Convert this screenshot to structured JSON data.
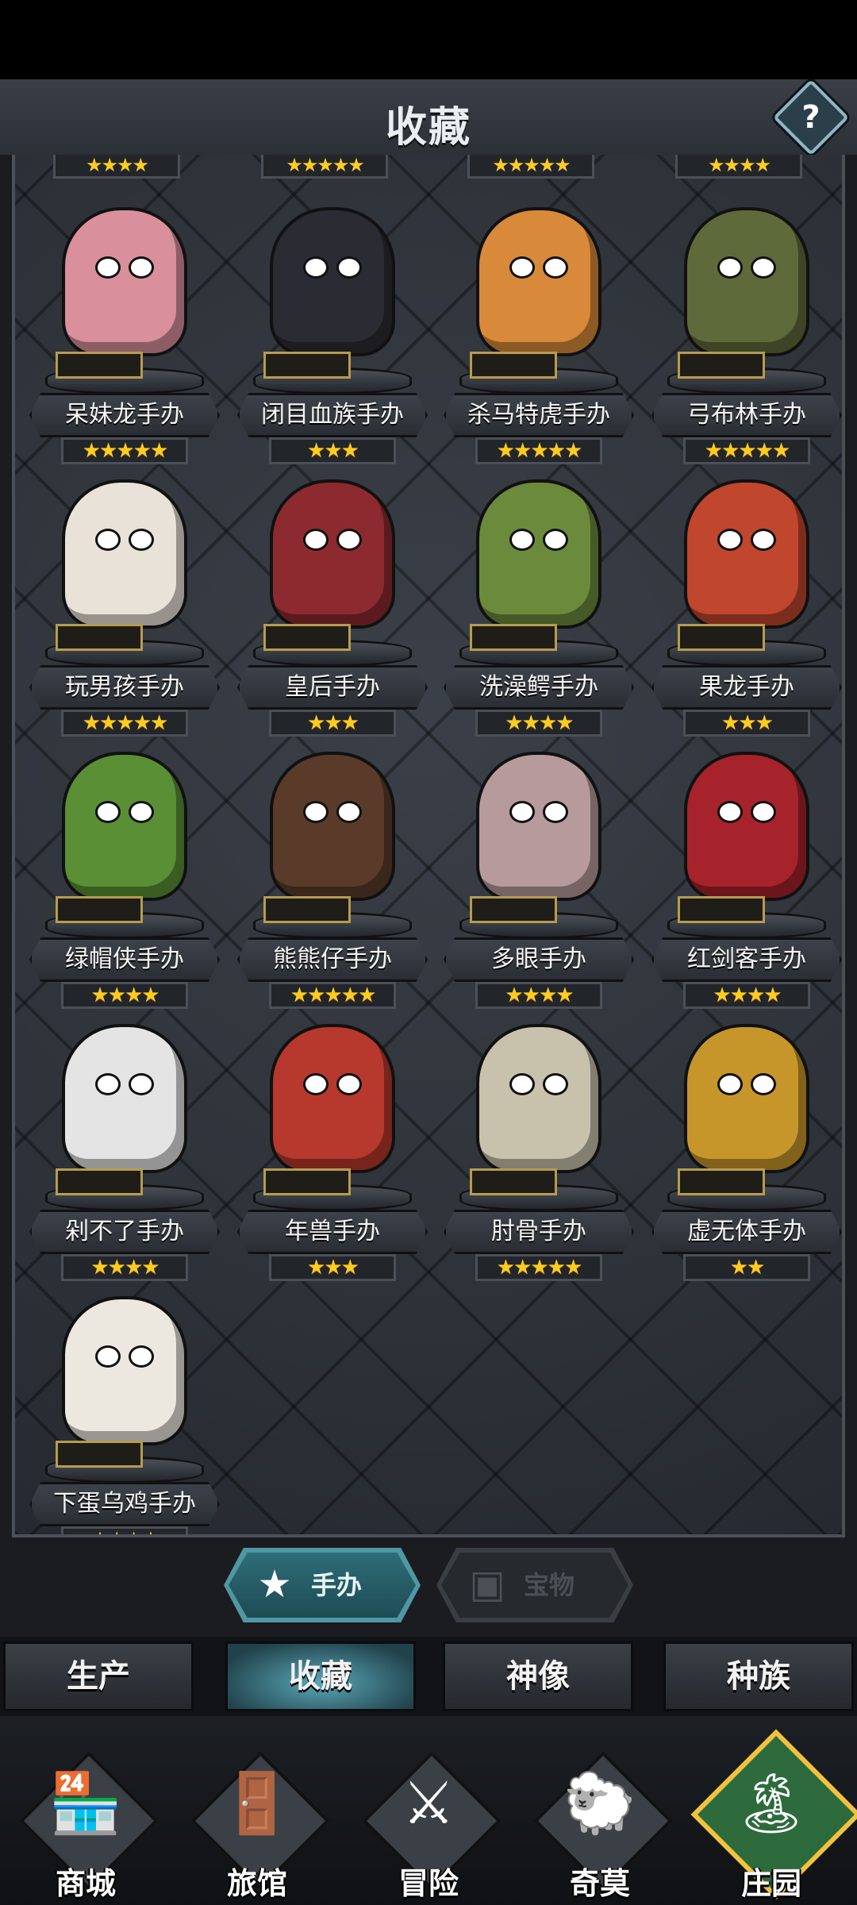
{
  "header": {
    "title": "收藏",
    "help_icon": "?"
  },
  "top_row_stars": [
    "★★★★",
    "★★★★★",
    "★★★★★",
    "★★★★"
  ],
  "figures": [
    {
      "name": "呆妹龙手办",
      "stars": "★★★★★",
      "color": "#d98f9c"
    },
    {
      "name": "闭目血族手办",
      "stars": "★★★",
      "color": "#2b2b33"
    },
    {
      "name": "杀马特虎手办",
      "stars": "★★★★★",
      "color": "#d88a3a"
    },
    {
      "name": "弓布林手办",
      "stars": "★★★★★",
      "color": "#5f6a3b"
    },
    {
      "name": "玩男孩手办",
      "stars": "★★★★★",
      "color": "#e8e2d8"
    },
    {
      "name": "皇后手办",
      "stars": "★★★",
      "color": "#8d2a2f"
    },
    {
      "name": "洗澡鳄手办",
      "stars": "★★★★",
      "color": "#6c8a3c"
    },
    {
      "name": "果龙手办",
      "stars": "★★★",
      "color": "#c0462e"
    },
    {
      "name": "绿帽侠手办",
      "stars": "★★★★",
      "color": "#5a8f35"
    },
    {
      "name": "熊熊仔手办",
      "stars": "★★★★★",
      "color": "#5a3b2a"
    },
    {
      "name": "多眼手办",
      "stars": "★★★★",
      "color": "#b79a9c"
    },
    {
      "name": "红剑客手办",
      "stars": "★★★★",
      "color": "#a7232b"
    },
    {
      "name": "剁不了手办",
      "stars": "★★★★",
      "color": "#e4e4e4"
    },
    {
      "name": "年兽手办",
      "stars": "★★★",
      "color": "#b7382c"
    },
    {
      "name": "肘骨手办",
      "stars": "★★★★★",
      "color": "#c8c2ad"
    },
    {
      "name": "虚无体手办",
      "stars": "★★",
      "color": "#c7962b"
    },
    {
      "name": "下蛋乌鸡手办",
      "stars": "★★★★",
      "color": "#ece7df"
    }
  ],
  "category_tabs": [
    {
      "label": "手办",
      "icon": "figure-star-icon",
      "active": true
    },
    {
      "label": "宝物",
      "icon": "chest-icon",
      "active": false
    }
  ],
  "subnav": [
    "生产",
    "收藏",
    "神像",
    "种族"
  ],
  "bottom_nav": [
    {
      "label": "商城",
      "icon": "shop-icon",
      "glyph": "🏪"
    },
    {
      "label": "旅馆",
      "icon": "gate-icon",
      "glyph": "🚪"
    },
    {
      "label": "冒险",
      "icon": "crossed-swords-icon",
      "glyph": "⚔"
    },
    {
      "label": "奇莫",
      "icon": "chimo-character-icon",
      "glyph": "🐑"
    },
    {
      "label": "庄园",
      "icon": "manor-island-icon",
      "glyph": "🏝"
    }
  ],
  "colors": {
    "accent": "#4f98a3",
    "star": "#ffcc22",
    "plaque_gold": "#b79b4e"
  }
}
